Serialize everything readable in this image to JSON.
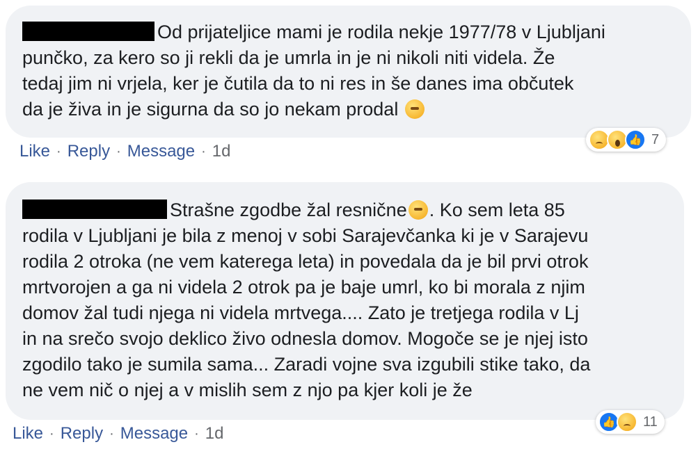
{
  "comments": [
    {
      "text": "Od prijateljice mami je rodila nekje 1977/78 v Ljubljani\npunčko, za kero so ji rekli da je umrla in je ni nikoli niti videla. Že\ntedaj jim ni vrjela, ker je čutila da to ni res in še danes ima občutek\nda je živa in je sigurna da so jo nekam prodal",
      "reactions": [
        "sad-reaction",
        "wow-reaction",
        "like-reaction"
      ],
      "reaction_count": "7",
      "actions": {
        "like": "Like",
        "reply": "Reply",
        "message": "Message",
        "time": "1d"
      }
    },
    {
      "text_part1": "Strašne zgodbe žal resnične",
      "text_part2": ". Ko sem leta 85\nrodila v Ljubljani je bila z menoj v sobi Sarajevčanka ki je v Sarajevu\nrodila 2 otroka (ne vem katerega leta) in povedala da je bil prvi otrok\nmrtvorojen a ga ni videla 2 otrok pa je baje umrl, ko bi morala z njim\ndomov žal tudi njega ni videla mrtvega.... Zato je tretjega rodila v Lj\nin na srečo svojo deklico živo odnesla domov. Mogoče se je njej isto\nzgodilo tako je sumila sama... Zaradi vojne sva izgubili stike tako, da\nne vem nič o njej a v mislih sem z njo pa kjer koli je že",
      "reactions": [
        "like-reaction",
        "sad-reaction"
      ],
      "reaction_count": "11",
      "actions": {
        "like": "Like",
        "reply": "Reply",
        "message": "Message",
        "time": "1d"
      }
    }
  ],
  "separator": "·",
  "colors": {
    "bubble": "#f0f2f5",
    "link": "#385898",
    "meta": "#65676b",
    "like_blue": "#1877f2"
  }
}
